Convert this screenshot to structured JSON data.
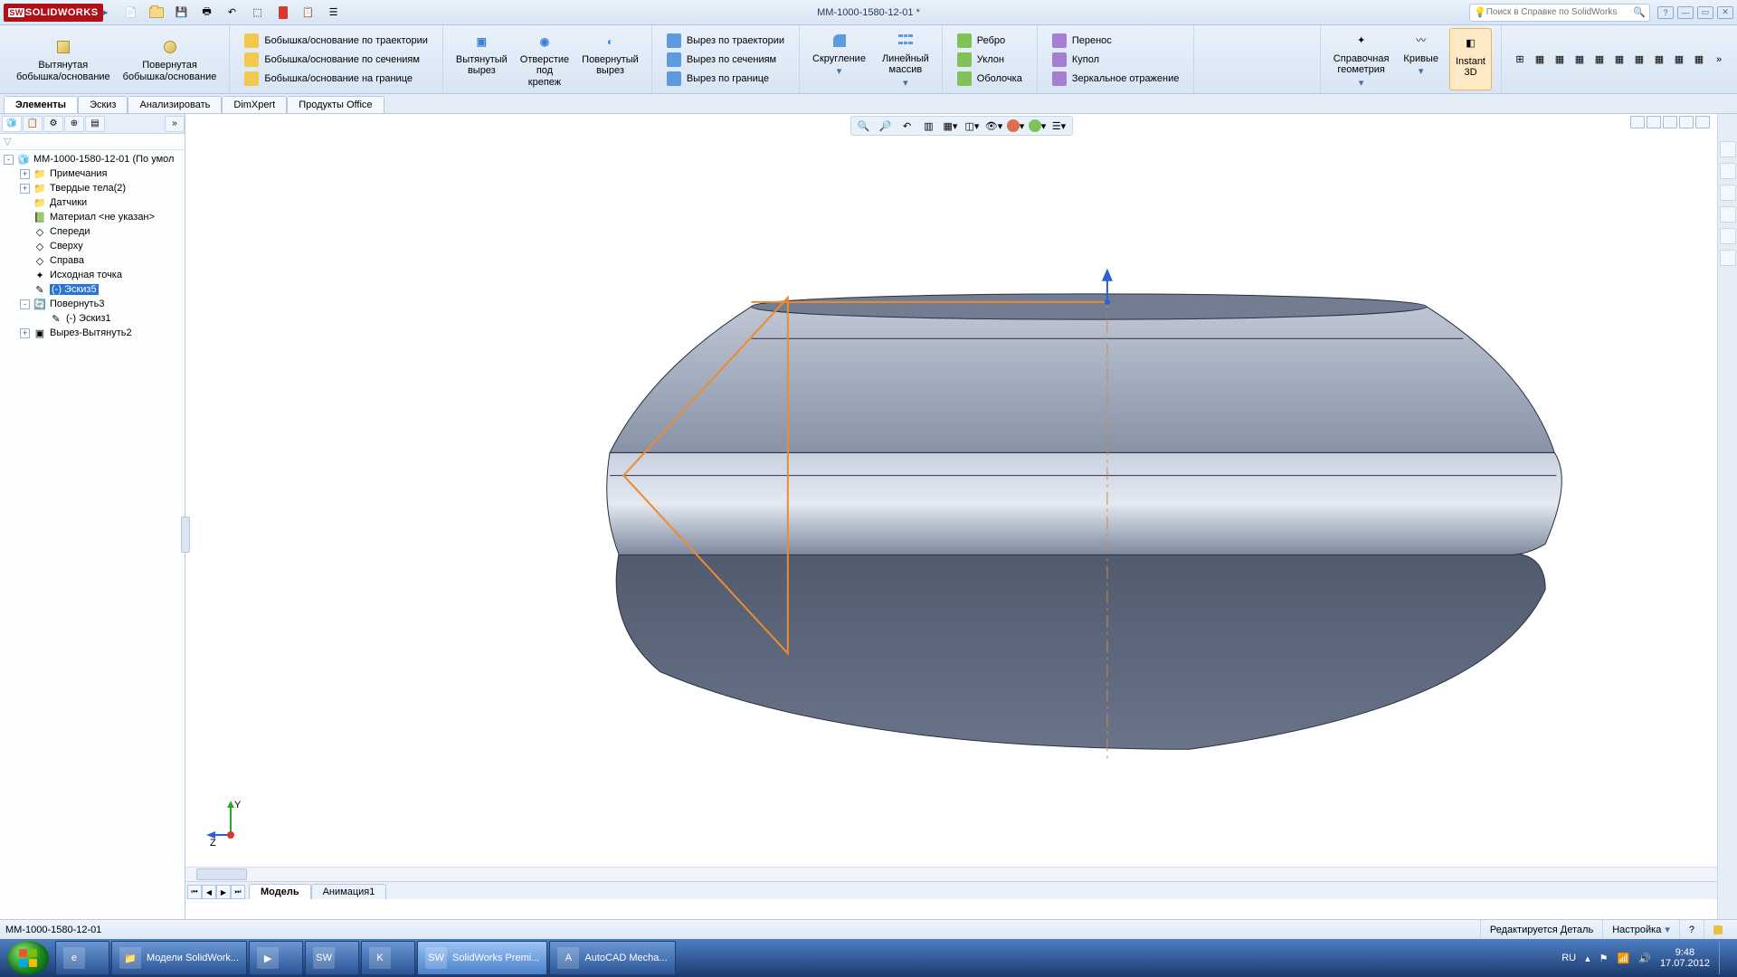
{
  "app": {
    "name": "SOLIDWORKS",
    "doc_title": "MM-1000-1580-12-01 *",
    "search_placeholder": "Поиск в Справке по SolidWorks"
  },
  "ribbon": {
    "main": [
      {
        "label": "Вытянутая\nбобышка/основание"
      },
      {
        "label": "Повернутая\nбобышка/основание"
      }
    ],
    "boss_stack": [
      "Бобышка/основание по траектории",
      "Бобышка/основание по сечениям",
      "Бобышка/основание на границе"
    ],
    "cut_main": [
      {
        "label": "Вытянутый\nвырез"
      },
      {
        "label": "Отверстие\nпод\nкрепеж"
      },
      {
        "label": "Повернутый\nвырез"
      }
    ],
    "cut_stack": [
      "Вырез по траектории",
      "Вырез по сечениям",
      "Вырез по границе"
    ],
    "feat1": [
      "Скругление",
      "Линейный\nмассив"
    ],
    "feat2_stack": [
      "Ребро",
      "Уклон",
      "Оболочка"
    ],
    "feat3_stack": [
      "Перенос",
      "Купол",
      "Зеркальное отражение"
    ],
    "right": [
      "Справочная\nгеометрия",
      "Кривые",
      "Instant\n3D"
    ]
  },
  "cmtabs": [
    "Элементы",
    "Эскиз",
    "Анализировать",
    "DimXpert",
    "Продукты Office"
  ],
  "tree": [
    {
      "exp": "-",
      "ico": "part",
      "label": "MM-1000-1580-12-01  (По умол",
      "indent": 0
    },
    {
      "exp": "+",
      "ico": "folder",
      "label": "Примечания",
      "indent": 1
    },
    {
      "exp": "+",
      "ico": "folder",
      "label": "Твердые тела(2)",
      "indent": 1
    },
    {
      "exp": "",
      "ico": "folder",
      "label": "Датчики",
      "indent": 1
    },
    {
      "exp": "",
      "ico": "mat",
      "label": "Материал <не указан>",
      "indent": 1
    },
    {
      "exp": "",
      "ico": "plane",
      "label": "Спереди",
      "indent": 1
    },
    {
      "exp": "",
      "ico": "plane",
      "label": "Сверху",
      "indent": 1
    },
    {
      "exp": "",
      "ico": "plane",
      "label": "Справа",
      "indent": 1
    },
    {
      "exp": "",
      "ico": "origin",
      "label": "Исходная точка",
      "indent": 1
    },
    {
      "exp": "",
      "ico": "sketch",
      "label": "(-) Эскиз5",
      "indent": 1,
      "sel": true
    },
    {
      "exp": "-",
      "ico": "rev",
      "label": "Повернуть3",
      "indent": 1
    },
    {
      "exp": "",
      "ico": "sketch",
      "label": "(-) Эскиз1",
      "indent": 2
    },
    {
      "exp": "+",
      "ico": "cut",
      "label": "Вырез-Вытянуть2",
      "indent": 1
    }
  ],
  "bottom_tabs": {
    "model": "Модель",
    "anim": "Анимация1"
  },
  "status": {
    "doc": "MM-1000-1580-12-01",
    "mode": "Редактируется Деталь",
    "custom": "Настройка"
  },
  "taskbar": {
    "items": [
      {
        "label": "",
        "img": "ie"
      },
      {
        "label": "Модели SolidWork...",
        "img": "folder"
      },
      {
        "label": "",
        "img": "wmp"
      },
      {
        "label": "",
        "img": "sw"
      },
      {
        "label": "",
        "img": "k"
      },
      {
        "label": "SolidWorks Premi...",
        "img": "sw",
        "active": true
      },
      {
        "label": "AutoCAD Mecha...",
        "img": "acad"
      }
    ],
    "lang": "RU",
    "time": "9:48",
    "date": "17.07.2012"
  },
  "triad": {
    "y": "Y",
    "z": "Z"
  }
}
